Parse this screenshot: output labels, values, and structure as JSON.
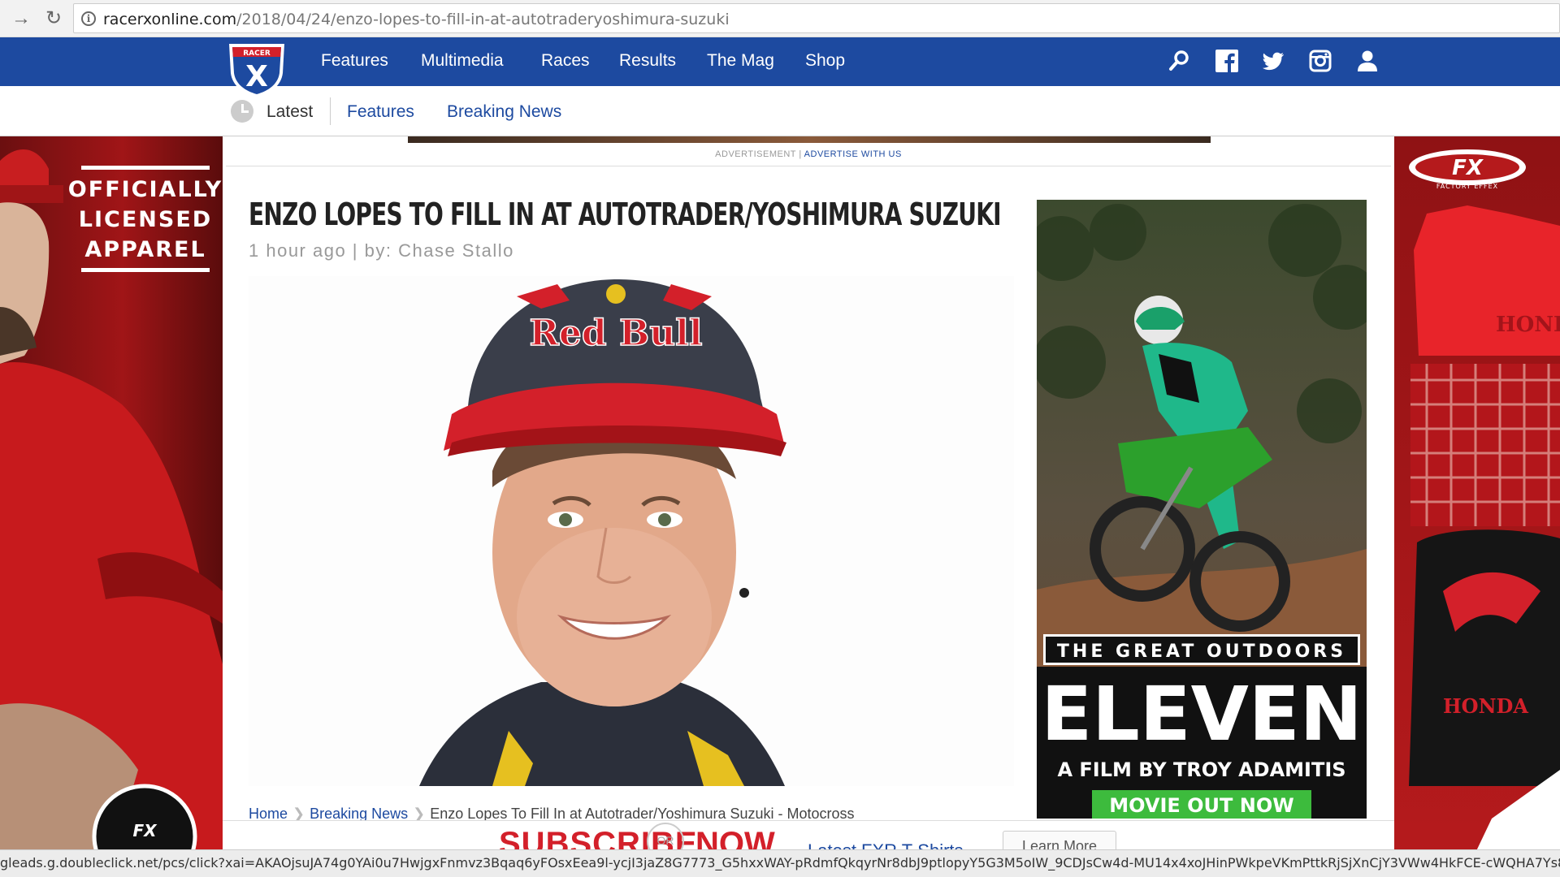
{
  "browser": {
    "url_domain": "racerxonline.com",
    "url_path": "/2018/04/24/enzo-lopes-to-fill-in-at-autotraderyoshimura-suzuki"
  },
  "site": {
    "logo_text": "RACER",
    "logo_letter": "X",
    "nav": [
      "Features",
      "Multimedia",
      "Races",
      "Results",
      "The Mag",
      "Shop"
    ],
    "icons": [
      "search-icon",
      "facebook-icon",
      "twitter-icon",
      "instagram-icon",
      "user-icon"
    ],
    "subnav": {
      "latest": "Latest",
      "items": [
        "Features",
        "Breaking News"
      ]
    },
    "colors": {
      "brand_blue": "#1d4aa0",
      "ad_red": "#b51a1c"
    }
  },
  "left_ad": {
    "text_lines": [
      "OFFICIALLY",
      "LICENSED",
      "APPAREL"
    ],
    "badge": "FX"
  },
  "right_ad": {
    "brand": "FX",
    "sub": "FACTORY EFFEX",
    "honda1": "HONDA",
    "honda2": "HONDA"
  },
  "article": {
    "ad_label": "ADVERTISEMENT",
    "ad_link": "ADVERTISE WITH US",
    "title": "ENZO LOPES TO FILL IN AT AUTOTRADER/YOSHIMURA SUZUKI",
    "byline": "1 hour ago  |  by: Chase Stallo",
    "breadcrumb": [
      "Home",
      "Breaking News"
    ],
    "breadcrumb_current": "Enzo Lopes To Fill In at Autotrader/Yoshimura Suzuki - Motocross"
  },
  "side_ad": {
    "line1": "THE GREAT OUTDOORS",
    "line2": "ELEVEN",
    "line3": "A FILM BY TROY ADAMITIS",
    "cta": "MOVIE OUT NOW"
  },
  "sticky": {
    "subscribe": "SUBSCRIBE",
    "or": "OR",
    "now": "NOW",
    "shirt": "Latest FXR T-Shirts",
    "learn": "Learn More"
  },
  "status_url": "gleads.g.doubleclick.net/pcs/click?xai=AKAOjsuJA74g0YAi0u7HwjgxFnmvz3Bqaq6yFOsxEea9l-ycjI3jaZ8G7773_G5hxxWAY-pRdmfQkqyrNr8dbJ9ptlopyY5G3M5oIW_9CDJsCw4d-MU14x4xoJHinPWkpeVKmPttkRjSjXnCjY3VWw4HkFCE-cWQHA7Ys8hypNANiZAgGnNuLSLgcE"
}
